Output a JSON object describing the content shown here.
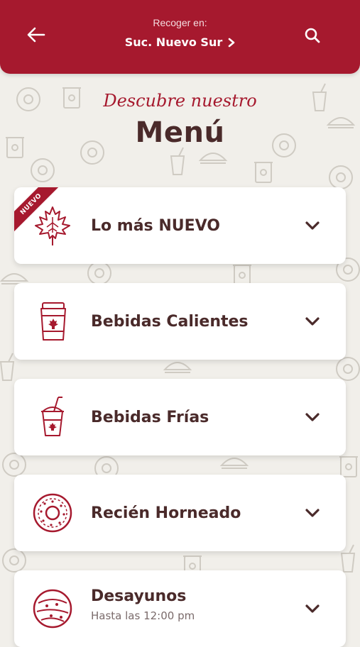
{
  "header": {
    "pickup_label": "Recoger en:",
    "store_name": "Suc. Nuevo Sur",
    "background_color": "#a6192e"
  },
  "intro": {
    "script_text": "Descubre nuestro",
    "title": "Menú"
  },
  "menu": {
    "items": [
      {
        "label": "Lo más NUEVO",
        "badge": "NUEVO",
        "icon": "maple-leaf-icon"
      },
      {
        "label": "Bebidas Calientes",
        "icon": "hot-cup-icon"
      },
      {
        "label": "Bebidas Frías",
        "icon": "cold-cup-icon"
      },
      {
        "label": "Recién Horneado",
        "icon": "donut-icon"
      },
      {
        "label": "Desayunos",
        "sublabel": "Hasta las 12:00 pm",
        "icon": "bagel-icon"
      }
    ]
  },
  "colors": {
    "accent": "#a6192e",
    "text_dark": "#4a2a2a",
    "background": "#f1efea"
  }
}
